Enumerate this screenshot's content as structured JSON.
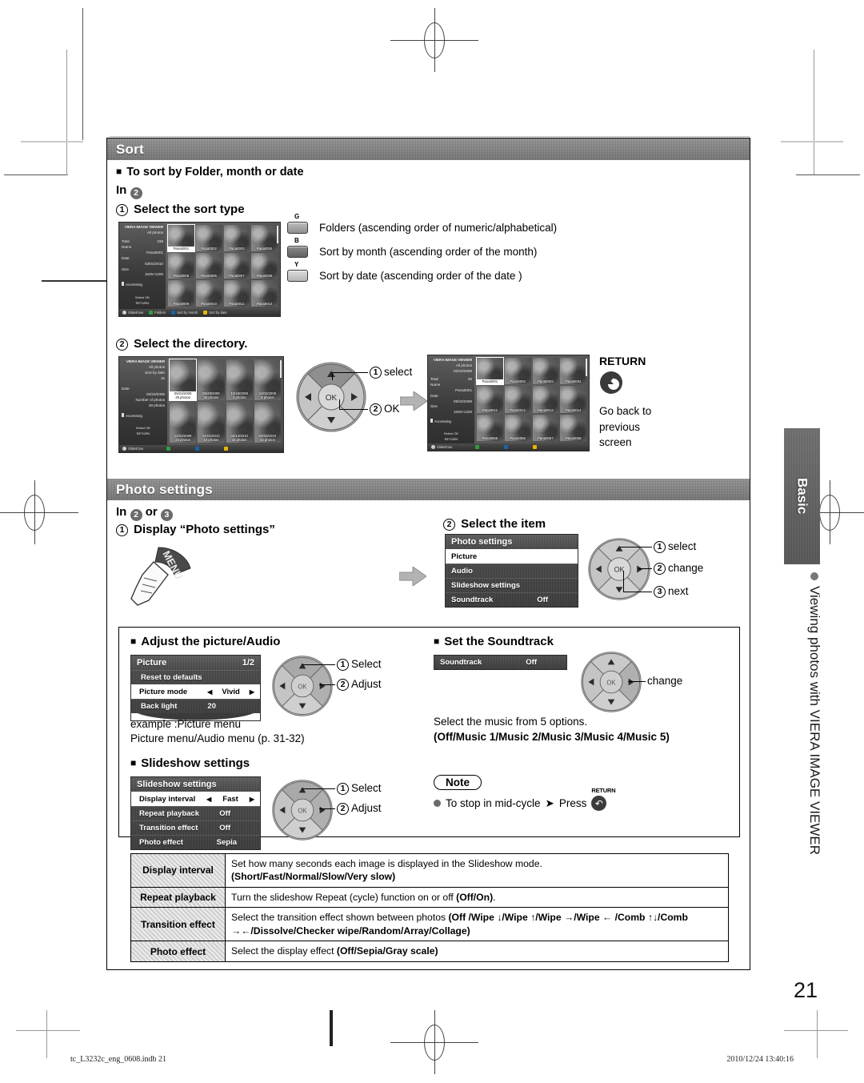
{
  "page": {
    "number": "21",
    "footer_left": "tc_L3232c_eng_0608.indb   21",
    "footer_right": "2010/12/24   13:40:16"
  },
  "side": {
    "tab_label": "Basic",
    "vertical_text": "Viewing photos with VIERA IMAGE VIEWER"
  },
  "sections": {
    "sort": {
      "header": "Sort",
      "subhead": "To sort by Folder, month or date",
      "in_label": "In",
      "in_num": "2",
      "step1_num": "1",
      "step1": "Select the sort type",
      "keys": [
        {
          "color_label": "G",
          "color_hex": "#2f9e44",
          "text": "Folders (ascending order of numeric/alphabetical)"
        },
        {
          "color_label": "B",
          "color_hex": "#1864ab",
          "text": "Sort by month (ascending order of the month)"
        },
        {
          "color_label": "Y",
          "color_hex": "#e6b800",
          "text": "Sort by date (ascending order of the date )"
        }
      ],
      "step2_num": "2",
      "step2": "Select the directory.",
      "dpad_1_num": "1",
      "dpad_1": "select",
      "dpad_2_num": "2",
      "dpad_2": "OK",
      "return_title": "RETURN",
      "return_text": "Go back to previous screen"
    },
    "photo_settings": {
      "header": "Photo settings",
      "in_label": "In",
      "in_num_a": "2",
      "in_or": "or",
      "in_num_b": "3",
      "step1_num": "1",
      "step1": "Display “Photo settings”",
      "menu_button": "MENU",
      "step2_num": "2",
      "step2": "Select the item",
      "dpad": [
        {
          "num": "1",
          "label": "select"
        },
        {
          "num": "2",
          "label": "change"
        },
        {
          "num": "3",
          "label": "next"
        }
      ]
    },
    "adjust": {
      "title": "Adjust the picture/Audio",
      "dpad": [
        {
          "num": "1",
          "label": "Select"
        },
        {
          "num": "2",
          "label": "Adjust"
        }
      ],
      "caption_1": "example :Picture menu",
      "caption_2": "Picture menu/Audio menu (p. 31-32)"
    },
    "soundtrack": {
      "title": "Set the Soundtrack",
      "dpad_label": "change",
      "text": "Select the music from 5 options.",
      "options": "(Off/Music 1/Music 2/Music 3/Music 4/Music 5)"
    },
    "slideshow": {
      "title": "Slideshow settings",
      "dpad": [
        {
          "num": "1",
          "label": "Select"
        },
        {
          "num": "2",
          "label": "Adjust"
        }
      ]
    },
    "note": {
      "label": "Note",
      "text_a": "To stop in mid-cycle",
      "text_b": "Press",
      "return_label": "RETURN"
    }
  },
  "osd": {
    "photo_settings": {
      "title": "Photo settings",
      "rows": [
        {
          "label": "Picture",
          "value": "",
          "selected": true
        },
        {
          "label": "Audio",
          "value": "",
          "selected": false
        },
        {
          "label": "Slideshow settings",
          "value": "",
          "selected": false
        },
        {
          "label": "Soundtrack",
          "value": "Off",
          "selected": false
        }
      ]
    },
    "picture": {
      "title": "Picture",
      "page": "1/2",
      "rows": [
        {
          "label": "Reset to defaults",
          "value": "",
          "selected": false,
          "arrows": false
        },
        {
          "label": "Picture mode",
          "value": "Vivid",
          "selected": true,
          "arrows": true
        },
        {
          "label": "Back light",
          "value": "20",
          "selected": false,
          "arrows": false
        }
      ]
    },
    "soundtrack": {
      "label": "Soundtrack",
      "value": "Off"
    },
    "slideshow": {
      "title": "Slideshow settings",
      "rows": [
        {
          "label": "Display interval",
          "value": "Fast",
          "selected": true,
          "arrows": true
        },
        {
          "label": "Repeat playback",
          "value": "Off",
          "selected": false,
          "arrows": false
        },
        {
          "label": "Transition effect",
          "value": "Off",
          "selected": false,
          "arrows": false
        },
        {
          "label": "Photo effect",
          "value": "Sepia",
          "selected": false,
          "arrows": false
        }
      ]
    }
  },
  "tv_screens": {
    "all_photos": {
      "title": "VIERA IMAGE VIEWER",
      "subtitle": "All photos",
      "info": [
        {
          "k": "Total",
          "v": "238"
        },
        {
          "k": "Name",
          "v": "Pana0001"
        },
        {
          "k": "Date",
          "v": "03/04/2010"
        },
        {
          "k": "Size",
          "v": "1625×1200"
        }
      ],
      "access": "Accessing",
      "hint_select": "Select",
      "hint_ok": "OK",
      "hint_return": "RETURN",
      "thumbs": [
        "Pana0001",
        "Pana0002",
        "Pana0003",
        "Pana0004",
        "Pana0005",
        "Pana0006",
        "Pana0007",
        "Pana0008",
        "Pana0009",
        "Pana0010",
        "Pana0011",
        "Pana0012"
      ],
      "selected_index": 0,
      "bottom": [
        {
          "label": "Slideshow",
          "chip": ""
        },
        {
          "label": "Folders",
          "chip": "#2f9e44"
        },
        {
          "label": "Sort by month",
          "chip": "#1864ab"
        },
        {
          "label": "Sort by date",
          "chip": "#e6b800"
        }
      ]
    },
    "directory": {
      "title": "VIERA IMAGE VIEWER",
      "subtitle": "All photos",
      "subtitle2": "Sort by date",
      "count": "15",
      "info": [
        {
          "k": "Date",
          "v": "03/23/2009"
        },
        {
          "k": "Number of photos",
          "v": "28 photos"
        }
      ],
      "access": "Accessing",
      "hint_select": "Select",
      "hint_ok": "OK",
      "hint_return": "RETURN",
      "thumbs": [
        {
          "date": "09/23/2009",
          "count": "28 photos"
        },
        {
          "date": "09/29/2009",
          "count": "34 photos"
        },
        {
          "date": "10/18/2009",
          "count": "3 photos"
        },
        {
          "date": "11/02/2009",
          "count": "8 photos"
        },
        {
          "date": "12/24/2009",
          "count": "24 photos"
        },
        {
          "date": "01/01/2010",
          "count": "10 photos"
        },
        {
          "date": "02/14/2010",
          "count": "15 photos"
        },
        {
          "date": "03/03/2010",
          "count": "32 photos"
        }
      ],
      "selected_index": 0,
      "bottom": [
        {
          "label": "Slideshow",
          "chip": ""
        },
        {
          "label": "",
          "chip": "#2f9e44"
        },
        {
          "label": "",
          "chip": "#1864ab"
        },
        {
          "label": "",
          "chip": "#e6b800"
        }
      ]
    },
    "dated_photos": {
      "title": "VIERA IMAGE VIEWER",
      "subtitle": "All photos",
      "subtitle2": "03/23/2009",
      "info": [
        {
          "k": "Total",
          "v": "28"
        },
        {
          "k": "Name",
          "v": "Pana0001"
        },
        {
          "k": "Date",
          "v": "09/23/2009"
        },
        {
          "k": "Size",
          "v": "1920×1200"
        }
      ],
      "access": "Accessing",
      "hint_select": "Select",
      "hint_ok": "OK",
      "hint_return": "RETURN",
      "thumbs": [
        "Pana0001",
        "Pana0002",
        "Pana0003",
        "Pana0004",
        "Pana0011",
        "Pana0012",
        "Pana0013",
        "Pana0014",
        "Pana0055",
        "Pana0056",
        "Pana0057",
        "Pana0058"
      ],
      "selected_index": 0,
      "bottom": [
        {
          "label": "Slideshow",
          "chip": ""
        },
        {
          "label": "",
          "chip": "#2f9e44"
        },
        {
          "label": "",
          "chip": "#1864ab"
        },
        {
          "label": "",
          "chip": "#e6b800"
        }
      ]
    }
  },
  "reference_table": {
    "rows": [
      {
        "key": "Display interval",
        "text": "Set how many seconds each image is displayed in the Slideshow mode.",
        "bold": "(Short/Fast/Normal/Slow/Very slow)",
        "bold_inline": false
      },
      {
        "key": "Repeat playback",
        "text": "Turn the slideshow Repeat (cycle) function on or off ",
        "bold": "(Off/On)",
        "tail": ".",
        "bold_inline": true
      },
      {
        "key": "Transition effect",
        "text": "Select the transition effect shown between photos ",
        "bold": "(Off /Wipe ↓/Wipe ↑/Wipe →/Wipe ← /Comb ↑↓/Comb →←/Dissolve/Checker wipe/Random/Array/Collage)",
        "bold_inline": true
      },
      {
        "key": "Photo effect",
        "text": "Select the display effect ",
        "bold": "(Off/Sepia/Gray scale)",
        "bold_inline": true
      }
    ]
  }
}
